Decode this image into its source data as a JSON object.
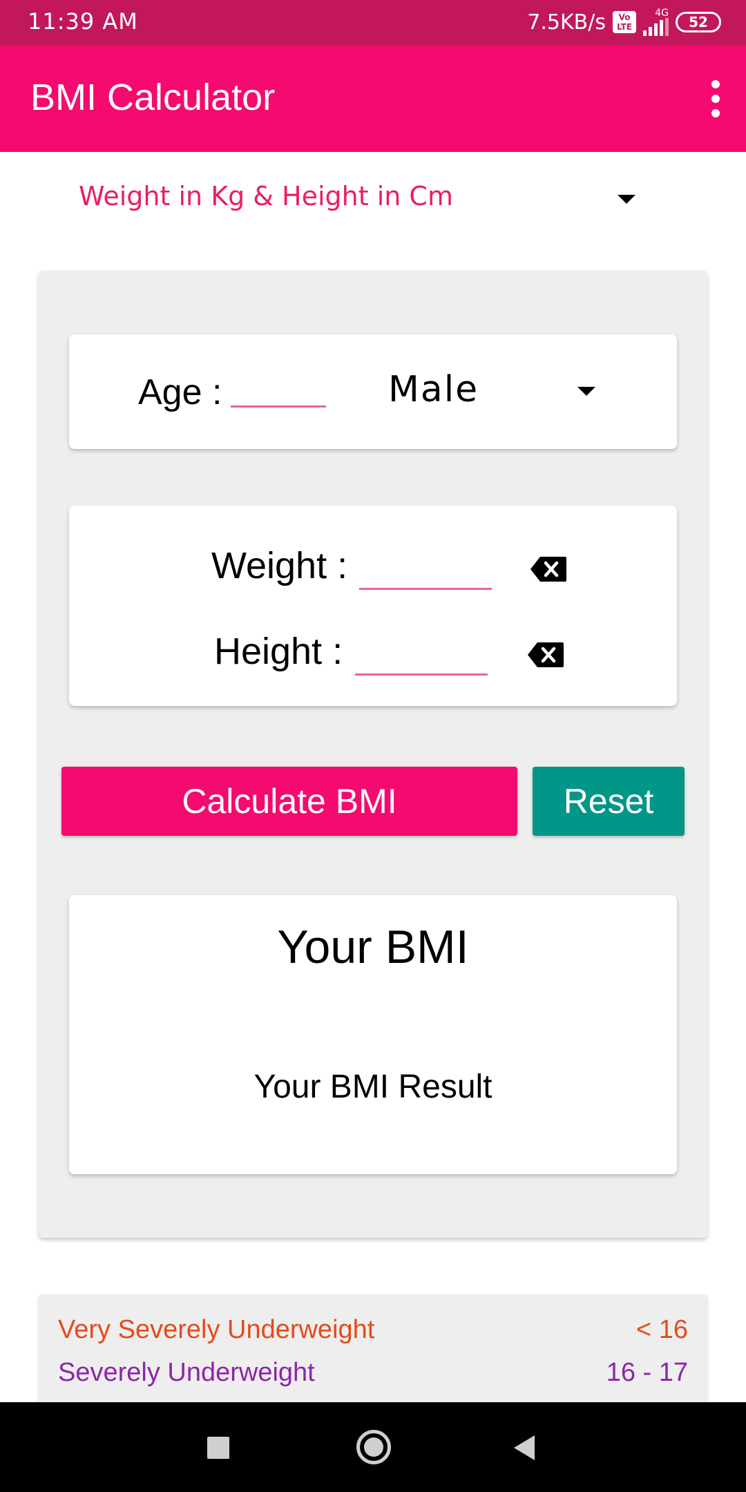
{
  "status_bar": {
    "time": "11:39 AM",
    "network_speed": "7.5KB/s",
    "volte_label": "Vo LTE",
    "network_type": "4G",
    "battery_level": "52"
  },
  "app_bar": {
    "title": "BMI Calculator"
  },
  "units": {
    "selected": "Weight in Kg & Height in Cm"
  },
  "age_card": {
    "age_label": "Age :",
    "age_value": "",
    "gender_selected": "Male"
  },
  "measurements": {
    "weight_label": "Weight :",
    "weight_value": "",
    "height_label": "Height :",
    "height_value": ""
  },
  "buttons": {
    "calculate_label": "Calculate BMI",
    "reset_label": "Reset"
  },
  "result": {
    "title": "Your BMI",
    "text": "Your BMI Result"
  },
  "categories": [
    {
      "name": "Very Severely Underweight",
      "range": "< 16",
      "color": "#e64a19"
    },
    {
      "name": "Severely Underweight",
      "range": "16 - 17",
      "color": "#8e24aa"
    }
  ],
  "colors": {
    "status_bar": "#c2185b",
    "app_bar": "#f50a70",
    "accent": "#e91e63",
    "reset": "#009688"
  }
}
